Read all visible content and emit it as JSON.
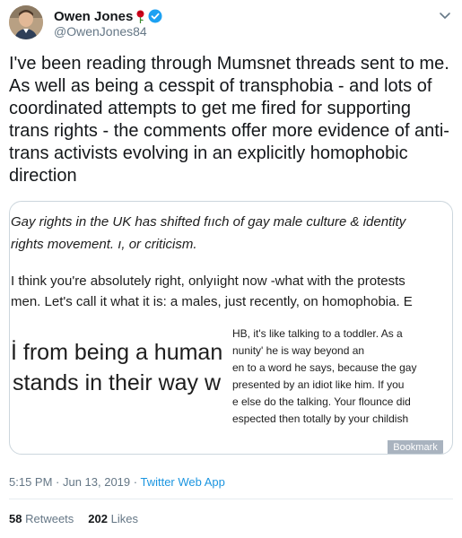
{
  "author": {
    "display_name": "Owen Jones",
    "handle": "@OwenJones84"
  },
  "icons": {
    "verified": "verified-badge-icon",
    "rose": "rose-emoji-icon",
    "caret": "chevron-down-icon"
  },
  "tweet": {
    "text": "I've been reading through Mumsnet threads sent to me. As well as being a cesspit of transphobia - and lots of coordinated attempts to get me fired for supporting trans rights - the comments offer more evidence of anti-trans activists evolving in an explicitly homophobic direction"
  },
  "image": {
    "lines": [
      "Gay rights in the UK has shifted fııch of gay male culture & identity",
      "rights movement.                              ı, or criticism.",
      "I think you're absolutely right, onlyıight now -what with the protests",
      "men. Let's call it what it is: a males, just recently, on homophobia. E",
      "İ from being a human",
      "stands in their way w",
      "HB, it's like talking to a toddler. As a",
      "nunity' he is way beyond an",
      "en to a word he says, because the gay",
      "presented by an idiot like him. If you",
      "e else do the talking. Your flounce did",
      "espected then totally by your childish"
    ],
    "bookmark_label": "Bookmark"
  },
  "meta": {
    "time": "5:15 PM · Jun 13, 2019 · ",
    "source": "Twitter Web App"
  },
  "stats": {
    "retweets_count": "58",
    "retweets_label": "Retweets",
    "likes_count": "202",
    "likes_label": "Likes"
  },
  "colors": {
    "verified_blue": "#1da1f2",
    "link_blue": "#1b95e0",
    "secondary_text": "#657786",
    "border": "#e6ecf0"
  }
}
